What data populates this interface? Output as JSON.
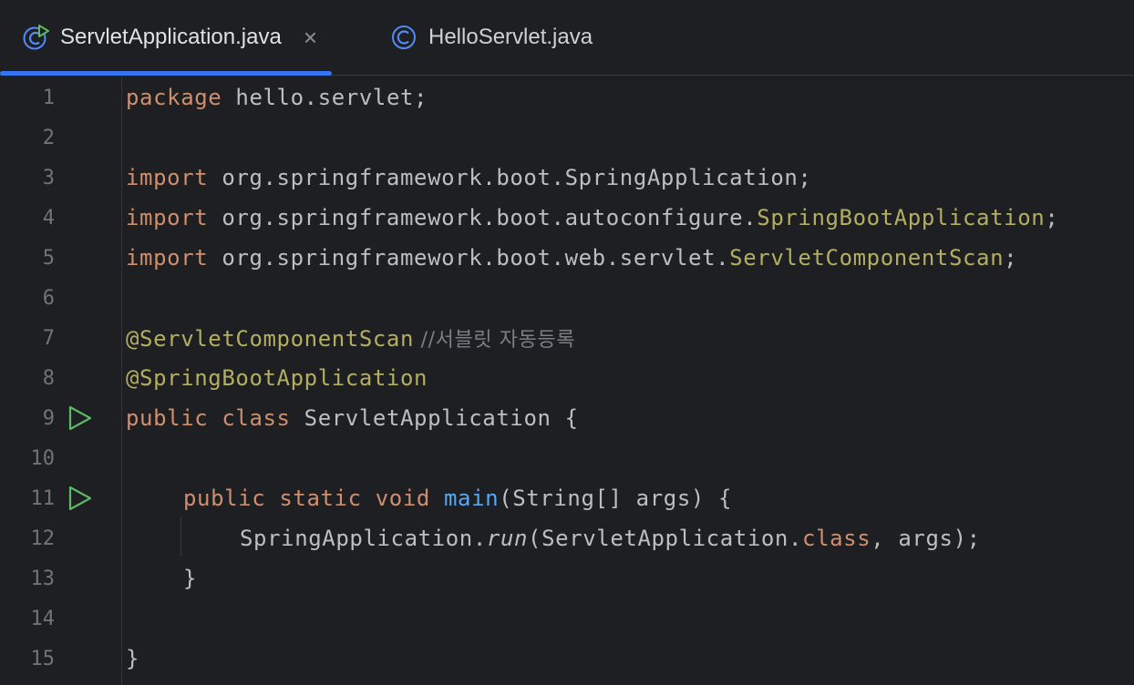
{
  "tabs": [
    {
      "label": "ServletApplication.java",
      "active": true,
      "icon": "spring-run-class-icon",
      "close": "×"
    },
    {
      "label": "HelloServlet.java",
      "active": false,
      "icon": "class-icon"
    }
  ],
  "colors": {
    "background": "#1e1f22",
    "keyword": "#cf8e6d",
    "annotation": "#b3ae60",
    "function": "#56a8f5",
    "comment": "#7a7e85",
    "text": "#bcbec4",
    "active_tab_underline": "#3574f0",
    "run_icon": "#5fb865"
  },
  "editor": {
    "line_numbers": [
      "1",
      "2",
      "3",
      "4",
      "5",
      "6",
      "7",
      "8",
      "9",
      "10",
      "11",
      "12",
      "13",
      "14",
      "15"
    ],
    "l1": {
      "kw": "package",
      "rest": " hello.servlet;"
    },
    "l3": {
      "kw": "import",
      "rest": " org.springframework.boot.SpringApplication;"
    },
    "l4": {
      "kw": "import",
      "pkg": " org.springframework.boot.autoconfigure.",
      "cls": "SpringBootApplication",
      "end": ";"
    },
    "l5": {
      "kw": "import",
      "pkg": " org.springframework.boot.web.servlet.",
      "cls": "ServletComponentScan",
      "end": ";"
    },
    "l7": {
      "ann": "@ServletComponentScan",
      "comment": " //서블릿 자동등록"
    },
    "l8": {
      "ann": "@SpringBootApplication"
    },
    "l9": {
      "kw1": "public",
      "kw2": "class",
      "rest": " ServletApplication {"
    },
    "l11": {
      "kw1": "public",
      "kw2": "static",
      "kw3": "void",
      "fn": "main",
      "rest": "(String[] args) {"
    },
    "l12": {
      "obj": "SpringApplication.",
      "method": "run",
      "arg": "(ServletApplication.",
      "kw": "class",
      "end": ", args);"
    },
    "l13": {
      "text": "}"
    },
    "l15": {
      "text": "}"
    }
  }
}
